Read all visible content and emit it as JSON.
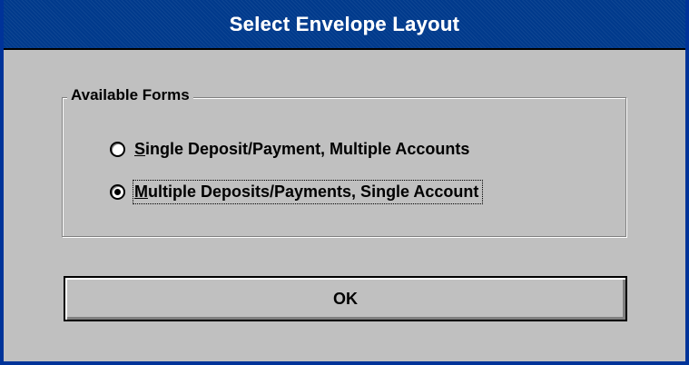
{
  "window": {
    "title": "Select Envelope Layout"
  },
  "group": {
    "label": "Available Forms",
    "options": [
      {
        "label": "Single Deposit/Payment, Multiple Accounts",
        "selected": false,
        "accelerator": "S"
      },
      {
        "label": "Multiple Deposits/Payments, Single Account",
        "selected": true,
        "accelerator": "M"
      }
    ]
  },
  "buttons": {
    "ok_label": "OK"
  },
  "colors": {
    "title_bar": "#003a8c",
    "dialog_bg": "#c0c0c0",
    "frame": "#003399"
  },
  "icons": {
    "unselected_radio": "radio-unchecked-icon",
    "selected_radio": "radio-checked-icon"
  }
}
